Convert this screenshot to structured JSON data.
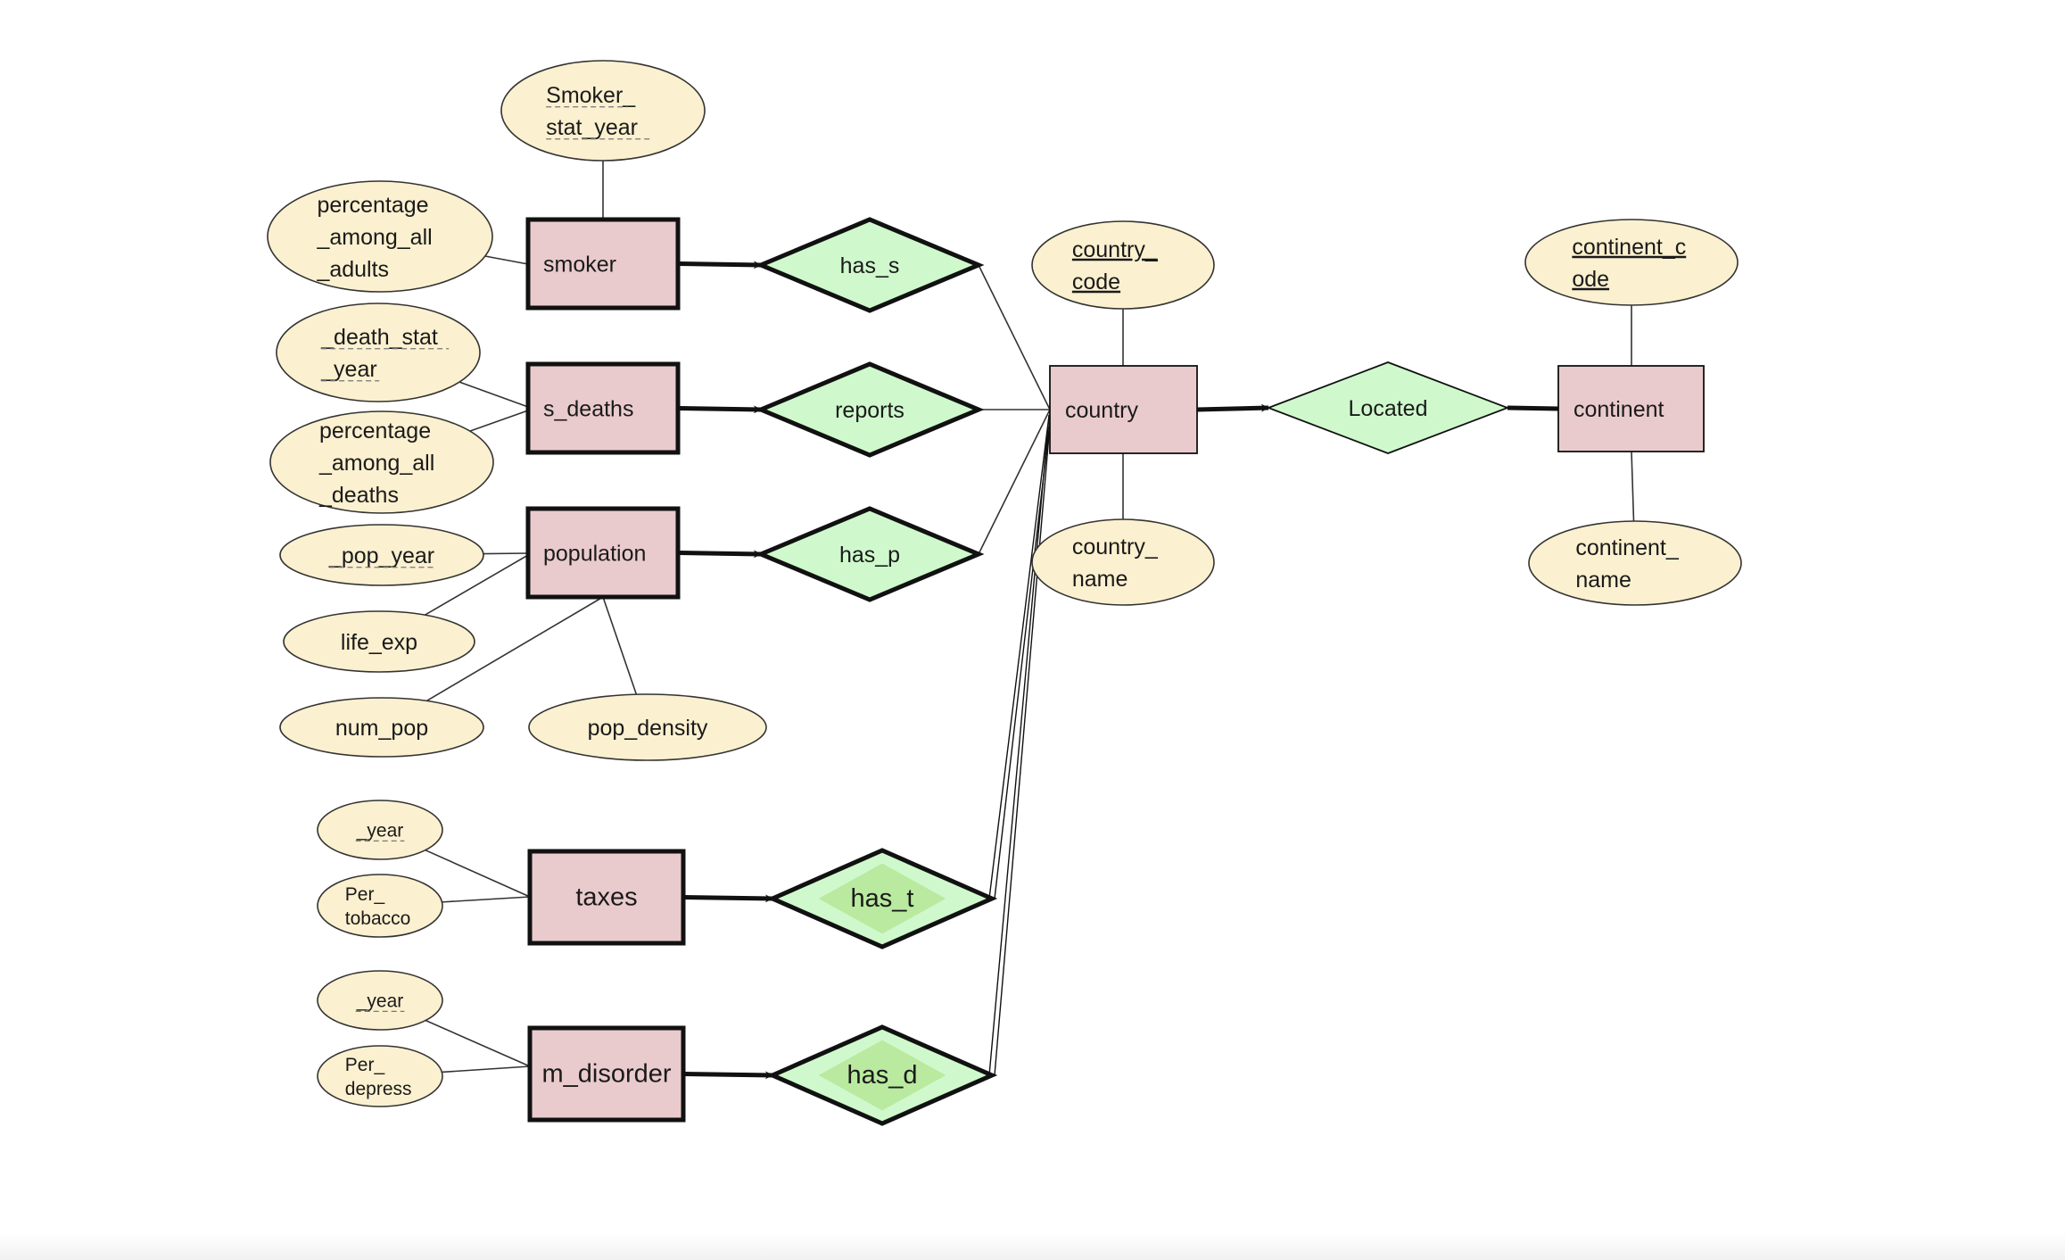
{
  "diagram": {
    "type": "er-diagram",
    "colors": {
      "entity_fill": "#eacbcd",
      "attribute_fill": "#fbf0cf",
      "relationship_fill": "#cff9cc",
      "identifying_inner_fill": "#b9ea9f",
      "stroke": "#111111"
    },
    "entities": [
      {
        "id": "smoker",
        "label": "smoker",
        "weak": true
      },
      {
        "id": "s_deaths",
        "label": "s_deaths",
        "weak": true
      },
      {
        "id": "population",
        "label": "population",
        "weak": true
      },
      {
        "id": "taxes",
        "label": "taxes",
        "weak": true
      },
      {
        "id": "m_disorder",
        "label": "m_disorder",
        "weak": true
      },
      {
        "id": "country",
        "label": "country",
        "weak": false
      },
      {
        "id": "continent",
        "label": "continent",
        "weak": false
      }
    ],
    "relationships": [
      {
        "id": "has_s",
        "label": "has_s",
        "identifying": true
      },
      {
        "id": "reports",
        "label": "reports",
        "identifying": true
      },
      {
        "id": "has_p",
        "label": "has_p",
        "identifying": true
      },
      {
        "id": "has_t",
        "label": "has_t",
        "identifying": true
      },
      {
        "id": "has_d",
        "label": "has_d",
        "identifying": true
      },
      {
        "id": "located",
        "label": "Located",
        "identifying": false
      }
    ],
    "attributes": [
      {
        "id": "smoker_stat_year",
        "lines": [
          "Smoker_",
          "stat_year"
        ],
        "key": "partial",
        "owner": "smoker"
      },
      {
        "id": "pct_adults",
        "lines": [
          "percentage",
          "_among_all",
          "_adults"
        ],
        "key": "none",
        "owner": "smoker"
      },
      {
        "id": "death_stat_year",
        "lines": [
          "_death_stat",
          "_year"
        ],
        "key": "partial",
        "owner": "s_deaths"
      },
      {
        "id": "pct_deaths",
        "lines": [
          "percentage",
          "_among_all",
          "_deaths"
        ],
        "key": "none",
        "owner": "s_deaths"
      },
      {
        "id": "pop_year",
        "lines": [
          "_pop_year"
        ],
        "key": "partial",
        "owner": "population"
      },
      {
        "id": "life_exp",
        "lines": [
          "life_exp"
        ],
        "key": "none",
        "owner": "population"
      },
      {
        "id": "num_pop",
        "lines": [
          "num_pop"
        ],
        "key": "none",
        "owner": "population"
      },
      {
        "id": "pop_density",
        "lines": [
          "pop_density"
        ],
        "key": "none",
        "owner": "population"
      },
      {
        "id": "taxes_year",
        "lines": [
          "_year"
        ],
        "key": "partial",
        "owner": "taxes"
      },
      {
        "id": "per_tobacco",
        "lines": [
          "Per_",
          "tobacco"
        ],
        "key": "none",
        "owner": "taxes"
      },
      {
        "id": "md_year",
        "lines": [
          "_year"
        ],
        "key": "partial",
        "owner": "m_disorder"
      },
      {
        "id": "per_depress",
        "lines": [
          "Per_",
          "depress"
        ],
        "key": "none",
        "owner": "m_disorder"
      },
      {
        "id": "country_code",
        "lines": [
          "country_",
          "code"
        ],
        "key": "primary",
        "owner": "country"
      },
      {
        "id": "country_name",
        "lines": [
          "country_",
          "name"
        ],
        "key": "none",
        "owner": "country"
      },
      {
        "id": "continent_code",
        "lines": [
          "continent_c",
          "ode"
        ],
        "key": "primary",
        "owner": "continent"
      },
      {
        "id": "continent_name",
        "lines": [
          "continent_",
          "name"
        ],
        "key": "none",
        "owner": "continent"
      }
    ],
    "links": [
      {
        "from": "smoker",
        "to": "has_s",
        "style": "arrow"
      },
      {
        "from": "s_deaths",
        "to": "reports",
        "style": "arrow"
      },
      {
        "from": "population",
        "to": "has_p",
        "style": "arrow"
      },
      {
        "from": "taxes",
        "to": "has_t",
        "style": "arrow"
      },
      {
        "from": "m_disorder",
        "to": "has_d",
        "style": "arrow"
      },
      {
        "from": "has_s",
        "to": "country",
        "style": "single"
      },
      {
        "from": "reports",
        "to": "country",
        "style": "single"
      },
      {
        "from": "has_p",
        "to": "country",
        "style": "single"
      },
      {
        "from": "has_t",
        "to": "country",
        "style": "double"
      },
      {
        "from": "has_d",
        "to": "country",
        "style": "double"
      },
      {
        "from": "country",
        "to": "located",
        "style": "arrow"
      },
      {
        "from": "located",
        "to": "continent",
        "style": "thick"
      }
    ]
  }
}
